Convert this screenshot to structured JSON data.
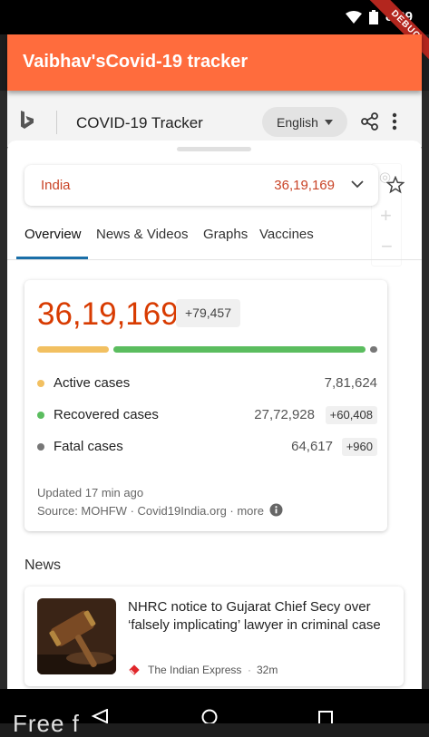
{
  "status_bar": {
    "time": "8:29",
    "debug_label": "DEBUG"
  },
  "app_bar": {
    "title": "Vaibhav'sCovid-19 tracker"
  },
  "web_header": {
    "title": "COVID-19 Tracker",
    "language": "English"
  },
  "country_selector": {
    "country": "India",
    "total": "36,19,169"
  },
  "tabs": [
    {
      "label": "Overview",
      "active": true
    },
    {
      "label": "News & Videos",
      "active": false
    },
    {
      "label": "Graphs",
      "active": false
    },
    {
      "label": "Vaccines",
      "active": false
    }
  ],
  "stats": {
    "total_cases": "36,19,169",
    "total_delta": "+79,457",
    "breakdown_fraction": {
      "active": 0.216,
      "recovered": 0.766,
      "fatal": 0.018
    },
    "rows": [
      {
        "label": "Active cases",
        "value": "7,81,624",
        "delta": "",
        "color": "#f2c061"
      },
      {
        "label": "Recovered cases",
        "value": "27,72,928",
        "delta": "+60,408",
        "color": "#5bbd5f"
      },
      {
        "label": "Fatal cases",
        "value": "64,617",
        "delta": "+960",
        "color": "#777777"
      }
    ],
    "updated": "Updated 17 min ago",
    "source": "Source: MOHFW · Covid19India.org · more"
  },
  "news": {
    "heading": "News",
    "items": [
      {
        "title": "NHRC notice to Gujarat Chief Secy over ‘falsely implicating’ lawyer in criminal case",
        "source": "The Indian Express",
        "time": "32m"
      }
    ]
  },
  "nav_overlay_text": "Free f",
  "colors": {
    "app_bar": "#ff6c3d",
    "accent": "#d83b01",
    "tab_underline": "#1a6fa8"
  }
}
